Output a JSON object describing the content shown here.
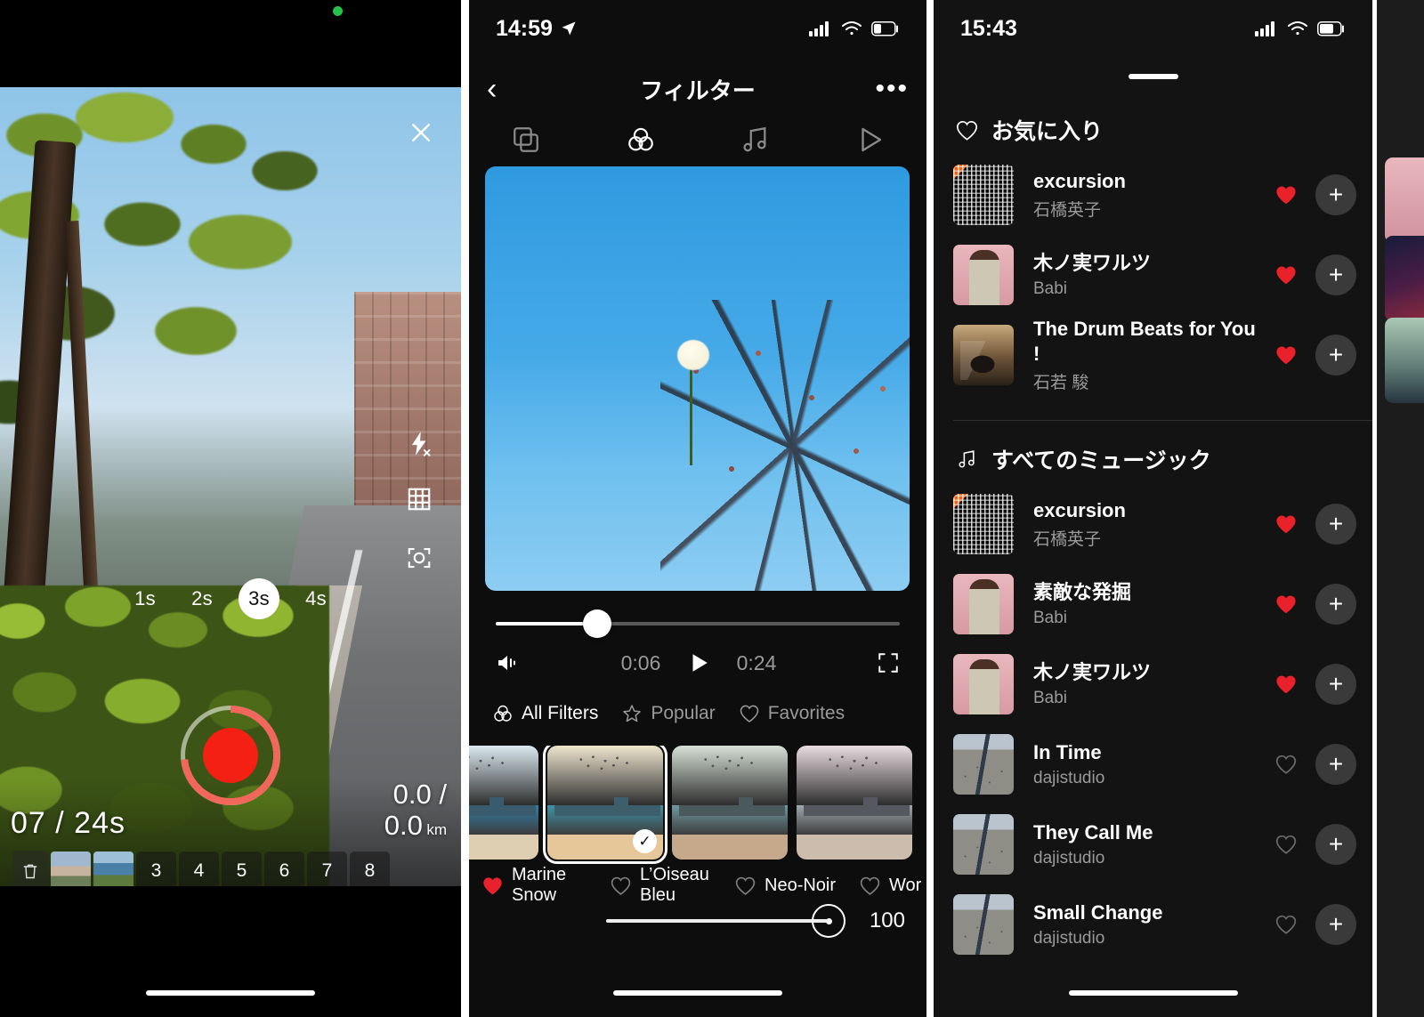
{
  "capture": {
    "recording_indicator": "camera-active",
    "icons": {
      "close": "close-icon",
      "flash_off": "flash-off-icon",
      "grid": "grid-icon",
      "flip": "camera-flip-icon"
    },
    "durations": [
      "1s",
      "2s",
      "3s",
      "4s"
    ],
    "selected_duration": "3s",
    "counter": "07 / 24s",
    "distance_current": "0.0 /",
    "distance_total": "0.0",
    "distance_unit": "km",
    "clip_slots": [
      "3",
      "4",
      "5",
      "6",
      "7",
      "8"
    ],
    "trash_label": "delete-clip"
  },
  "filter": {
    "status": {
      "time": "14:59",
      "location_icon": "location-arrow-icon"
    },
    "nav": {
      "back": "‹",
      "title": "フィルター",
      "more": "•••"
    },
    "tabs": [
      {
        "name": "layers",
        "label": "layers-icon"
      },
      {
        "name": "filters",
        "label": "filters-icon",
        "active": true
      },
      {
        "name": "music",
        "label": "music-icon"
      },
      {
        "name": "play",
        "label": "play-icon"
      }
    ],
    "player": {
      "current_time": "0:06",
      "total_time": "0:24",
      "progress_percent": 25,
      "volume_icon": "volume-icon",
      "play_icon": "play-icon",
      "fullscreen_icon": "fullscreen-icon"
    },
    "filter_tabs": [
      {
        "label": "All Filters",
        "icon": "filters-icon",
        "active": true
      },
      {
        "label": "Popular",
        "icon": "star-icon",
        "active": false
      },
      {
        "label": "Favorites",
        "icon": "heart-icon",
        "active": false
      }
    ],
    "presets": [
      {
        "label": "Marine Snow",
        "favorite": true,
        "selected": false,
        "sky": "#dbeaf0",
        "sea": "#2f7fa8",
        "sand": "#dfcfb2",
        "pier": "#3a5a6e"
      },
      {
        "label": "L’Oiseau Bleu",
        "favorite": false,
        "selected": true,
        "sky": "#efe6cf",
        "sea": "#3e93a8",
        "sand": "#e6c79a",
        "pier": "#3c5f6b"
      },
      {
        "label": "Neo-Noir",
        "favorite": false,
        "selected": false,
        "sky": "#d7e0d7",
        "sea": "#6f9aa0",
        "sand": "#c6a98b",
        "pier": "#4a5a5c"
      },
      {
        "label": "Wor",
        "favorite": false,
        "selected": false,
        "sky": "#e9dde2",
        "sea": "#9fa7ae",
        "sand": "#cbbcae",
        "pier": "#55585e"
      }
    ],
    "intensity": {
      "value": "100",
      "percent": 100
    }
  },
  "music": {
    "status": {
      "time": "15:43"
    },
    "sections": [
      {
        "id": "favorites",
        "icon": "heart-icon",
        "title": "お気に入り"
      },
      {
        "id": "all",
        "icon": "music-note-icon",
        "title": "すべてのミュージック"
      }
    ],
    "favorites": [
      {
        "title": "excursion",
        "artist": "石橋英子",
        "favorite": true,
        "art": "art-excursion",
        "corner": true
      },
      {
        "title": "木ノ実ワルツ",
        "artist": "Babi",
        "favorite": true,
        "art": "art-babi",
        "corner": false
      },
      {
        "title": "The Drum Beats for You !",
        "artist": "石若 駿",
        "favorite": true,
        "art": "art-drum",
        "corner": false
      }
    ],
    "all_music": [
      {
        "title": "excursion",
        "artist": "石橋英子",
        "favorite": true,
        "art": "art-excursion",
        "corner": true
      },
      {
        "title": "素敵な発掘",
        "artist": "Babi",
        "favorite": true,
        "art": "art-babi",
        "corner": false
      },
      {
        "title": "木ノ実ワルツ",
        "artist": "Babi",
        "favorite": true,
        "art": "art-babi",
        "corner": false
      },
      {
        "title": "In Time",
        "artist": "dajistudio",
        "favorite": false,
        "art": "art-daji",
        "corner": false
      },
      {
        "title": "They Call Me",
        "artist": "dajistudio",
        "favorite": false,
        "art": "art-daji",
        "corner": false
      },
      {
        "title": "Small Change",
        "artist": "dajistudio",
        "favorite": false,
        "art": "art-daji",
        "corner": false
      }
    ],
    "add_label": "+"
  },
  "colors": {
    "accent_red": "#e8212a",
    "record_red": "#f32013",
    "record_ring": "#f1675c",
    "camera_active_green": "#23c24a",
    "orange_corner": "#f2620f",
    "background": "#000000",
    "panel_background": "#131313",
    "secondary_text": "#9a9a9a"
  }
}
